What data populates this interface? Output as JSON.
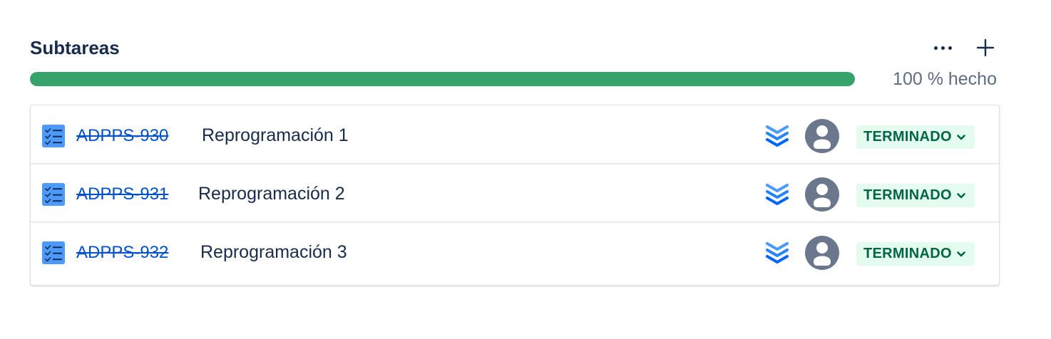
{
  "section": {
    "title": "Subtareas",
    "more_icon": "more-horizontal-icon",
    "add_icon": "plus-icon"
  },
  "progress": {
    "percent_done": 100,
    "label": "100 % hecho",
    "fill_color": "#36a46a"
  },
  "colors": {
    "key_link": "#0052cc",
    "status_bg": "#e3fcef",
    "status_text": "#006644",
    "priority": "#2684ff",
    "subtask_icon": "#4c9aff",
    "avatar_bg": "#6b778c"
  },
  "subtasks": [
    {
      "key": "ADPPS-930",
      "summary": "Reprogramación 1",
      "priority_icon": "priority-lowest-icon",
      "assignee_icon": "avatar-icon",
      "status": "TERMINADO"
    },
    {
      "key": "ADPPS-931",
      "summary": "Reprogramación 2",
      "priority_icon": "priority-lowest-icon",
      "assignee_icon": "avatar-icon",
      "status": "TERMINADO"
    },
    {
      "key": "ADPPS-932",
      "summary": "Reprogramación 3",
      "priority_icon": "priority-lowest-icon",
      "assignee_icon": "avatar-icon",
      "status": "TERMINADO"
    }
  ]
}
